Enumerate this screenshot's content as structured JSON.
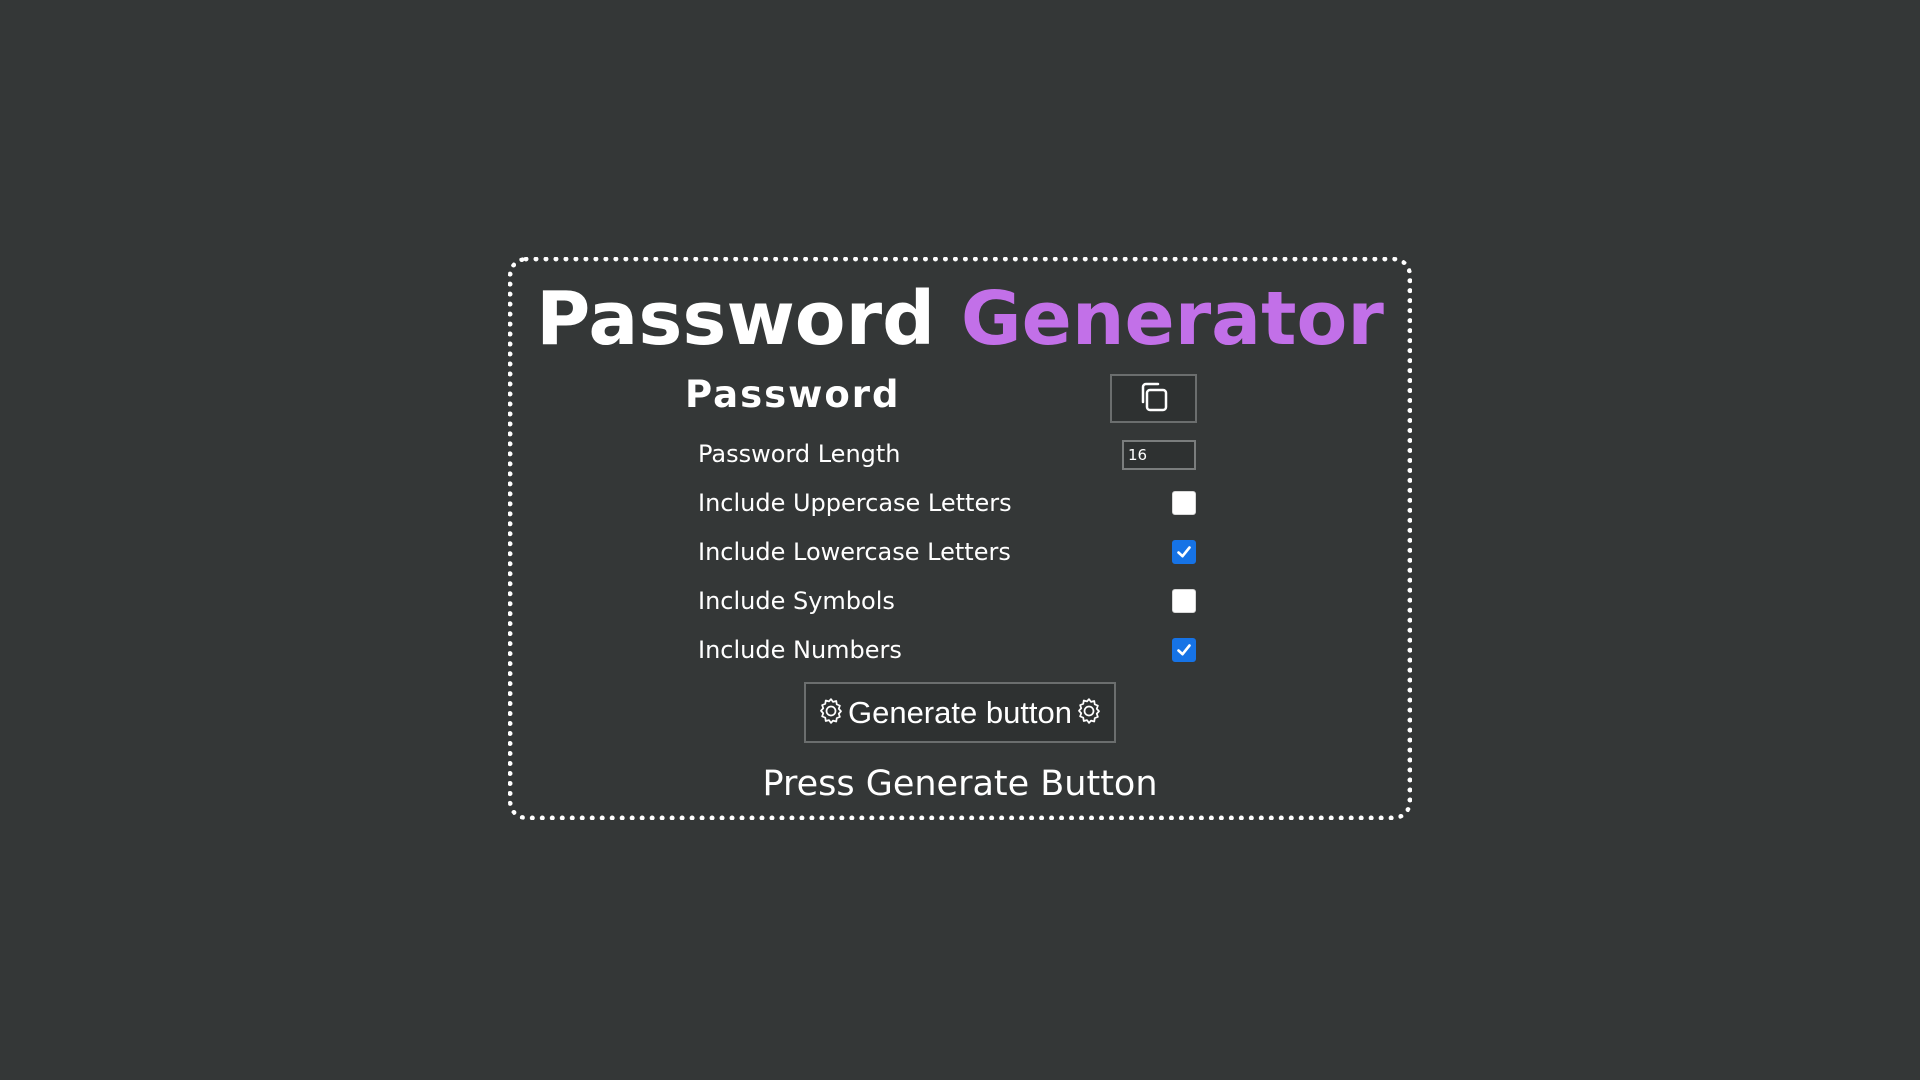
{
  "title": {
    "part1": "Password",
    "part2": "Generator",
    "accent_color": "#c270e8"
  },
  "password": {
    "label": "Password",
    "copy_icon": "copy-icon"
  },
  "options": {
    "length": {
      "label": "Password Length",
      "value": "16"
    },
    "uppercase": {
      "label": "Include Uppercase Letters",
      "checked": false
    },
    "lowercase": {
      "label": "Include Lowercase Letters",
      "checked": true
    },
    "symbols": {
      "label": "Include Symbols",
      "checked": false
    },
    "numbers": {
      "label": "Include Numbers",
      "checked": true
    }
  },
  "generate": {
    "label": "Generate button",
    "icon": "gear-icon"
  },
  "status": "Press Generate Button",
  "colors": {
    "background": "#343737",
    "checkbox_checked": "#1673e6"
  }
}
